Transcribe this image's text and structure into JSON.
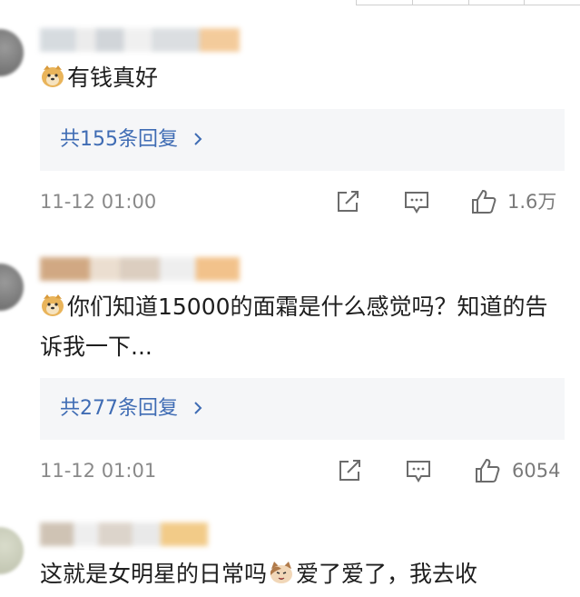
{
  "comments": [
    {
      "text": "有钱真好",
      "replies_label": "共155条回复",
      "time": "11-12 01:00",
      "likes": "1.6万"
    },
    {
      "text": "你们知道15000的面霜是什么感觉吗？知道的告诉我一下...",
      "replies_label": "共277条回复",
      "time": "11-12 01:01",
      "likes": "6054"
    },
    {
      "text_before_emoji": "这就是女明星的日常吗",
      "text_after_emoji": "爱了爱了，我去收"
    }
  ],
  "icons": {
    "doge": "doge-emoji",
    "cat": "cat-emoji",
    "share": "share-icon",
    "comment": "comment-icon",
    "like": "thumbs-up-icon",
    "chevron": "chevron-right-icon"
  },
  "colors": {
    "link": "#3f6cb4",
    "reply_bg": "#f5f6f8",
    "meta": "#8a8a8a"
  }
}
